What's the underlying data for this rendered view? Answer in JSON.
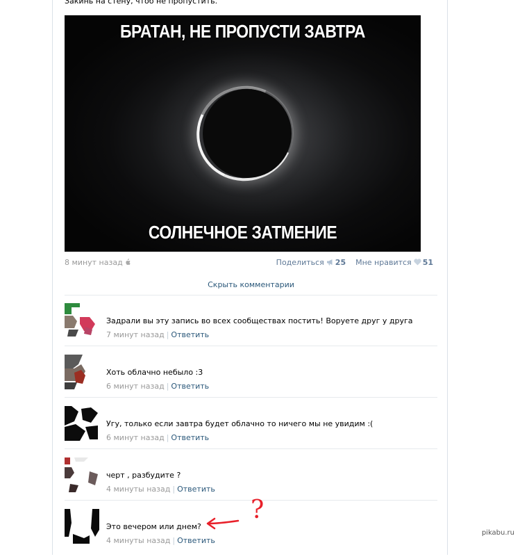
{
  "post": {
    "intro_text": "Закинь на стену, чтоб не пропустить.",
    "image": {
      "top_text": "БРАТАН, НЕ ПРОПУСТИ ЗАВТРА",
      "bottom_text": "СОЛНЕЧНОЕ ЗАТМЕНИЕ"
    },
    "time": "8 минут назад",
    "share_label": "Поделиться",
    "share_count": "25",
    "like_label": "Мне нравится",
    "like_count": "51",
    "hide_comments_label": "Скрыть комментарии"
  },
  "comments": [
    {
      "text": "Задрали вы эту запись во всех сообществах постить! Воруете друг у друга",
      "time": "7 минут назад",
      "reply": "Ответить"
    },
    {
      "text": "Хоть облачно небыло :3",
      "time": "6 минут назад",
      "reply": "Ответить"
    },
    {
      "text": "Угу, только если завтра будет облачно то ничего мы не увидим :(",
      "time": "6 минут назад",
      "reply": "Ответить"
    },
    {
      "text": "черт , разбудите ?",
      "time": "4 минуты назад",
      "reply": "Ответить"
    },
    {
      "text": "Это вечером или днем?",
      "time": "4 минуты назад",
      "reply": "Ответить"
    }
  ],
  "annotation": {
    "question_mark": "?"
  },
  "watermark": "pikabu.ru",
  "colors": {
    "link": "#2b587a",
    "meta_grey": "#999999",
    "accent_blue": "#5e7896",
    "annotation_red": "#e8202a"
  }
}
